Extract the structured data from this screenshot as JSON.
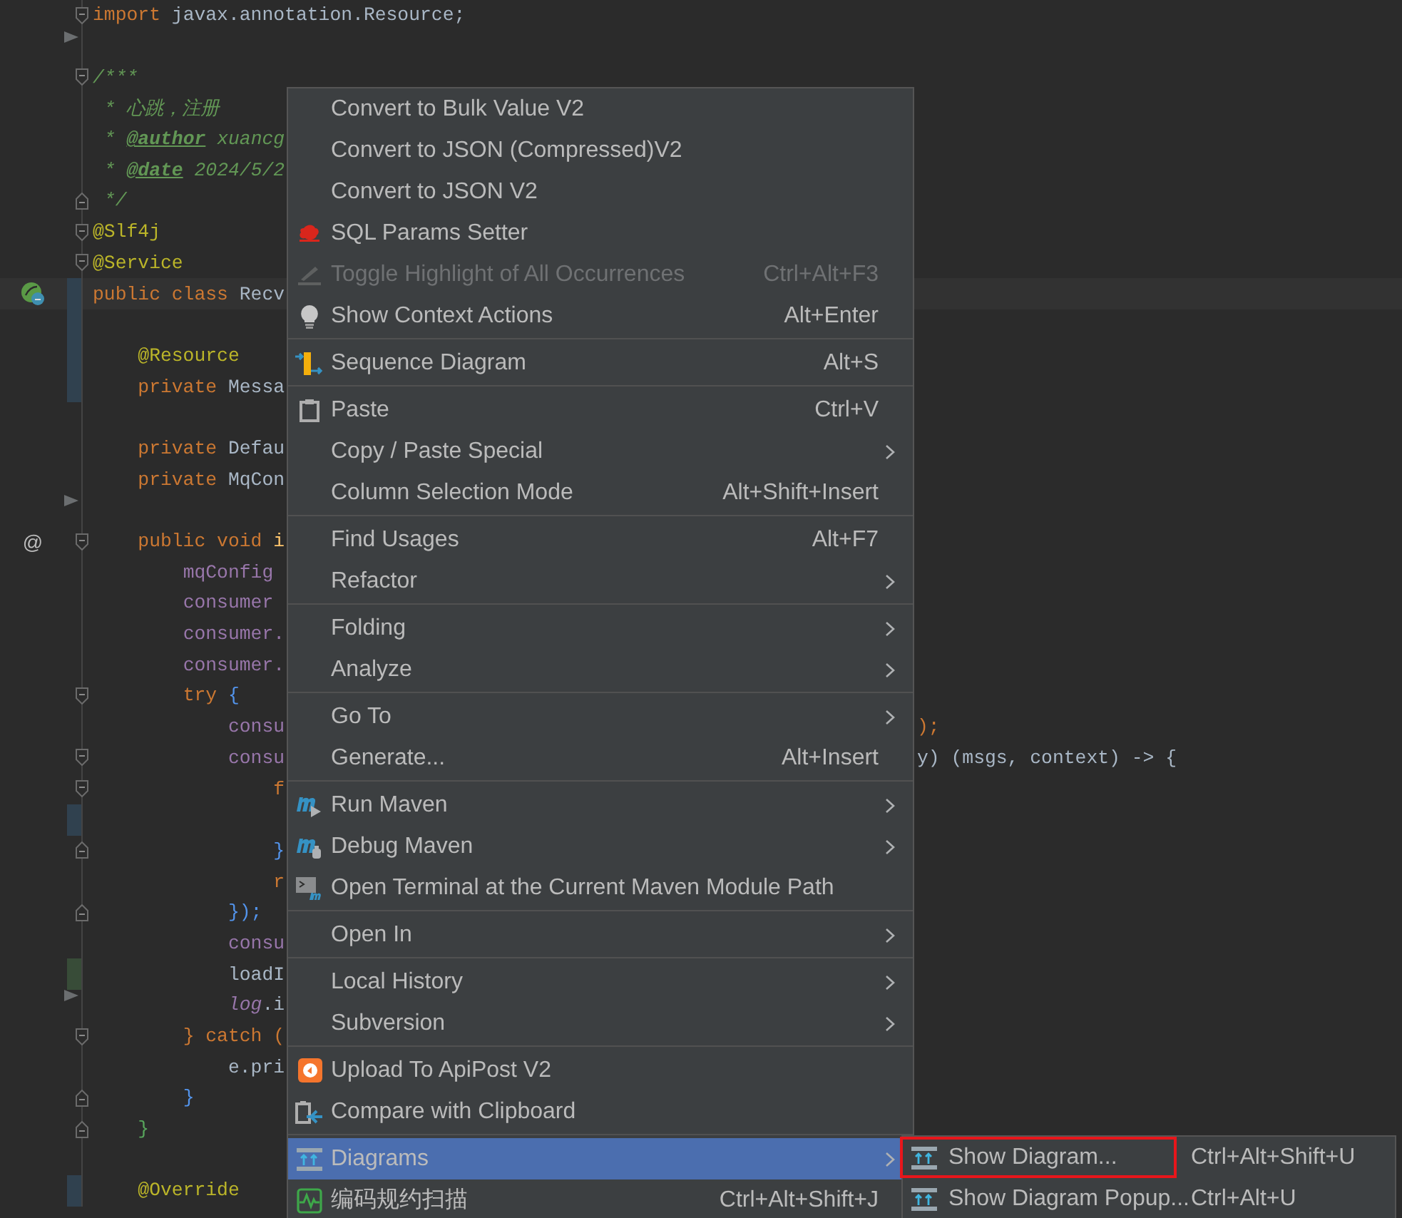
{
  "editor": {
    "lines": [
      {
        "tokens": [
          {
            "text": "import",
            "kind": "kw"
          },
          {
            "text": " javax.annotation.Resource;",
            "kind": "plain"
          }
        ],
        "gutter": [
          {
            "kind": "fold-open"
          }
        ]
      },
      {
        "gutter": [
          {
            "kind": "fold-arrow"
          }
        ]
      },
      {
        "tokens": [
          {
            "text": "/***",
            "kind": "comment"
          }
        ],
        "gutter": [
          {
            "kind": "fold-open"
          }
        ]
      },
      {
        "tokens": [
          {
            "text": " * 心跳，注册",
            "kind": "comment"
          }
        ]
      },
      {
        "tokens": [
          {
            "text": " * ",
            "kind": "comment"
          },
          {
            "text": "@author",
            "kind": "doctag"
          },
          {
            "text": " xuancg",
            "kind": "comment"
          }
        ]
      },
      {
        "tokens": [
          {
            "text": " * ",
            "kind": "comment"
          },
          {
            "text": "@date",
            "kind": "doctag"
          },
          {
            "text": " 2024/5/2",
            "kind": "comment"
          }
        ]
      },
      {
        "tokens": [
          {
            "text": " */",
            "kind": "comment"
          }
        ],
        "gutter": [
          {
            "kind": "fold-close"
          }
        ]
      },
      {
        "tokens": [
          {
            "text": "@Slf4j",
            "kind": "annotation"
          }
        ],
        "gutter": [
          {
            "kind": "fold-open"
          }
        ]
      },
      {
        "tokens": [
          {
            "text": "@Service",
            "kind": "annotation"
          }
        ],
        "gutter": [
          {
            "kind": "fold-open"
          }
        ]
      },
      {
        "tokens": [
          {
            "text": "public class ",
            "kind": "kw"
          },
          {
            "text": "Recv",
            "kind": "plain"
          }
        ],
        "current": true,
        "gutter": [
          {
            "kind": "bean"
          },
          {
            "kind": "change-modified"
          }
        ]
      },
      {
        "gutter": [
          {
            "kind": "change-modified"
          }
        ]
      },
      {
        "tokens": [
          {
            "text": "    @Resource",
            "kind": "annotation"
          }
        ],
        "gutter": [
          {
            "kind": "change-modified"
          }
        ]
      },
      {
        "tokens": [
          {
            "text": "    private ",
            "kind": "kw"
          },
          {
            "text": "Messa",
            "kind": "plain"
          }
        ],
        "gutter": [
          {
            "kind": "change-modified"
          }
        ]
      },
      {
        "kind": "blank"
      },
      {
        "tokens": [
          {
            "text": "    private ",
            "kind": "kw"
          },
          {
            "text": "Defau",
            "kind": "plain"
          }
        ]
      },
      {
        "tokens": [
          {
            "text": "    private ",
            "kind": "kw"
          },
          {
            "text": "MqCon",
            "kind": "plain"
          }
        ]
      },
      {
        "gutter": [
          {
            "kind": "fold-arrow"
          }
        ]
      },
      {
        "tokens": [
          {
            "text": "    public void ",
            "kind": "kw"
          },
          {
            "text": "i",
            "kind": "method"
          }
        ],
        "gutter": [
          {
            "kind": "at",
            "text": "@"
          },
          {
            "kind": "fold-open"
          }
        ]
      },
      {
        "tokens": [
          {
            "text": "        mqConfig",
            "kind": "field"
          }
        ]
      },
      {
        "tokens": [
          {
            "text": "        consumer",
            "kind": "field"
          }
        ]
      },
      {
        "tokens": [
          {
            "text": "        consumer.",
            "kind": "field"
          }
        ]
      },
      {
        "tokens": [
          {
            "text": "        consumer.",
            "kind": "field"
          }
        ]
      },
      {
        "tokens": [
          {
            "text": "        try ",
            "kind": "kw"
          },
          {
            "text": "{",
            "kind": "brace"
          }
        ],
        "gutter": [
          {
            "kind": "fold-open"
          }
        ]
      },
      {
        "tokens": [
          {
            "text": "            consu",
            "kind": "field"
          }
        ],
        "tail": [
          {
            "text": ");",
            "kind": "kw"
          }
        ]
      },
      {
        "tokens": [
          {
            "text": "            consu",
            "kind": "field"
          }
        ],
        "tail": [
          {
            "text": "y) (msgs, context) -> {",
            "kind": "plain"
          }
        ],
        "gutter": [
          {
            "kind": "fold-open"
          }
        ]
      },
      {
        "tokens": [
          {
            "text": "                f",
            "kind": "kw"
          }
        ],
        "gutter": [
          {
            "kind": "fold-open"
          }
        ]
      },
      {
        "gutter": [
          {
            "kind": "change-modified"
          }
        ]
      },
      {
        "tokens": [
          {
            "text": "                }",
            "kind": "brace"
          }
        ],
        "gutter": [
          {
            "kind": "fold-close"
          }
        ]
      },
      {
        "tokens": [
          {
            "text": "                r",
            "kind": "kw"
          }
        ]
      },
      {
        "tokens": [
          {
            "text": "            });",
            "kind": "brace"
          }
        ],
        "gutter": [
          {
            "kind": "fold-close"
          }
        ]
      },
      {
        "tokens": [
          {
            "text": "            consu",
            "kind": "field"
          }
        ]
      },
      {
        "tokens": [
          {
            "text": "            loadI",
            "kind": "plain"
          }
        ],
        "gutter": [
          {
            "kind": "change-added"
          }
        ]
      },
      {
        "tokens": [
          {
            "text": "            log",
            "kind": "static"
          },
          {
            "text": ".i",
            "kind": "plain"
          }
        ],
        "gutter": [
          {
            "kind": "fold-arrow"
          }
        ]
      },
      {
        "tokens": [
          {
            "text": "        } catch (",
            "kind": "kw"
          }
        ],
        "gutter": [
          {
            "kind": "fold-open"
          }
        ]
      },
      {
        "tokens": [
          {
            "text": "            e.pri",
            "kind": "plain"
          }
        ]
      },
      {
        "tokens": [
          {
            "text": "        }",
            "kind": "brace"
          }
        ],
        "gutter": [
          {
            "kind": "fold-close"
          }
        ]
      },
      {
        "tokens": [
          {
            "text": "    }",
            "kind": "green"
          }
        ],
        "gutter": [
          {
            "kind": "fold-close"
          }
        ]
      },
      {
        "kind": "blank"
      },
      {
        "tokens": [
          {
            "text": "    @Override",
            "kind": "annotation"
          }
        ],
        "gutter": [
          {
            "kind": "change-modified"
          }
        ]
      }
    ]
  },
  "context_menu": {
    "groups": [
      [
        {
          "label": "Convert to Bulk Value V2"
        },
        {
          "label": "Convert to JSON (Compressed)V2"
        },
        {
          "label": "Convert to JSON V2"
        },
        {
          "label": "SQL Params Setter",
          "kind": "sql"
        },
        {
          "label": "Toggle Highlight of All Occurrences",
          "shortcut": "Ctrl+Alt+F3",
          "kind": "pencil",
          "disabled": true
        },
        {
          "label": "Show Context Actions",
          "shortcut": "Alt+Enter",
          "kind": "bulb"
        }
      ],
      [
        {
          "label": "Sequence Diagram",
          "shortcut": "Alt+S",
          "kind": "sequence"
        }
      ],
      [
        {
          "label": "Paste",
          "shortcut": "Ctrl+V",
          "kind": "clipboard"
        },
        {
          "label": "Copy / Paste Special",
          "submenu": true
        },
        {
          "label": "Column Selection Mode",
          "shortcut": "Alt+Shift+Insert"
        }
      ],
      [
        {
          "label": "Find Usages",
          "shortcut": "Alt+F7"
        },
        {
          "label": "Refactor",
          "submenu": true
        }
      ],
      [
        {
          "label": "Folding",
          "submenu": true
        },
        {
          "label": "Analyze",
          "submenu": true
        }
      ],
      [
        {
          "label": "Go To",
          "submenu": true
        },
        {
          "label": "Generate...",
          "shortcut": "Alt+Insert"
        }
      ],
      [
        {
          "label": "Run Maven",
          "kind": "maven-run",
          "submenu": true
        },
        {
          "label": "Debug Maven",
          "kind": "maven-debug",
          "submenu": true
        },
        {
          "label": "Open Terminal at the Current Maven Module Path",
          "kind": "terminal"
        }
      ],
      [
        {
          "label": "Open In",
          "submenu": true
        }
      ],
      [
        {
          "label": "Local History",
          "submenu": true
        },
        {
          "label": "Subversion",
          "submenu": true
        }
      ],
      [
        {
          "label": "Upload To ApiPost V2",
          "kind": "apipost"
        },
        {
          "label": "Compare with Clipboard",
          "kind": "compare"
        }
      ],
      [
        {
          "label": "Diagrams",
          "kind": "diagram",
          "submenu": true,
          "selected": true
        },
        {
          "label": "编码规约扫描",
          "shortcut": "Ctrl+Alt+Shift+J",
          "kind": "scan",
          "selected": false
        }
      ]
    ]
  },
  "submenu": {
    "items": [
      {
        "label": "Show Diagram...",
        "shortcut": "Ctrl+Alt+Shift+U",
        "annotated": true
      },
      {
        "label": "Show Diagram Popup...",
        "shortcut": "Ctrl+Alt+U",
        "annotated": false
      }
    ]
  }
}
